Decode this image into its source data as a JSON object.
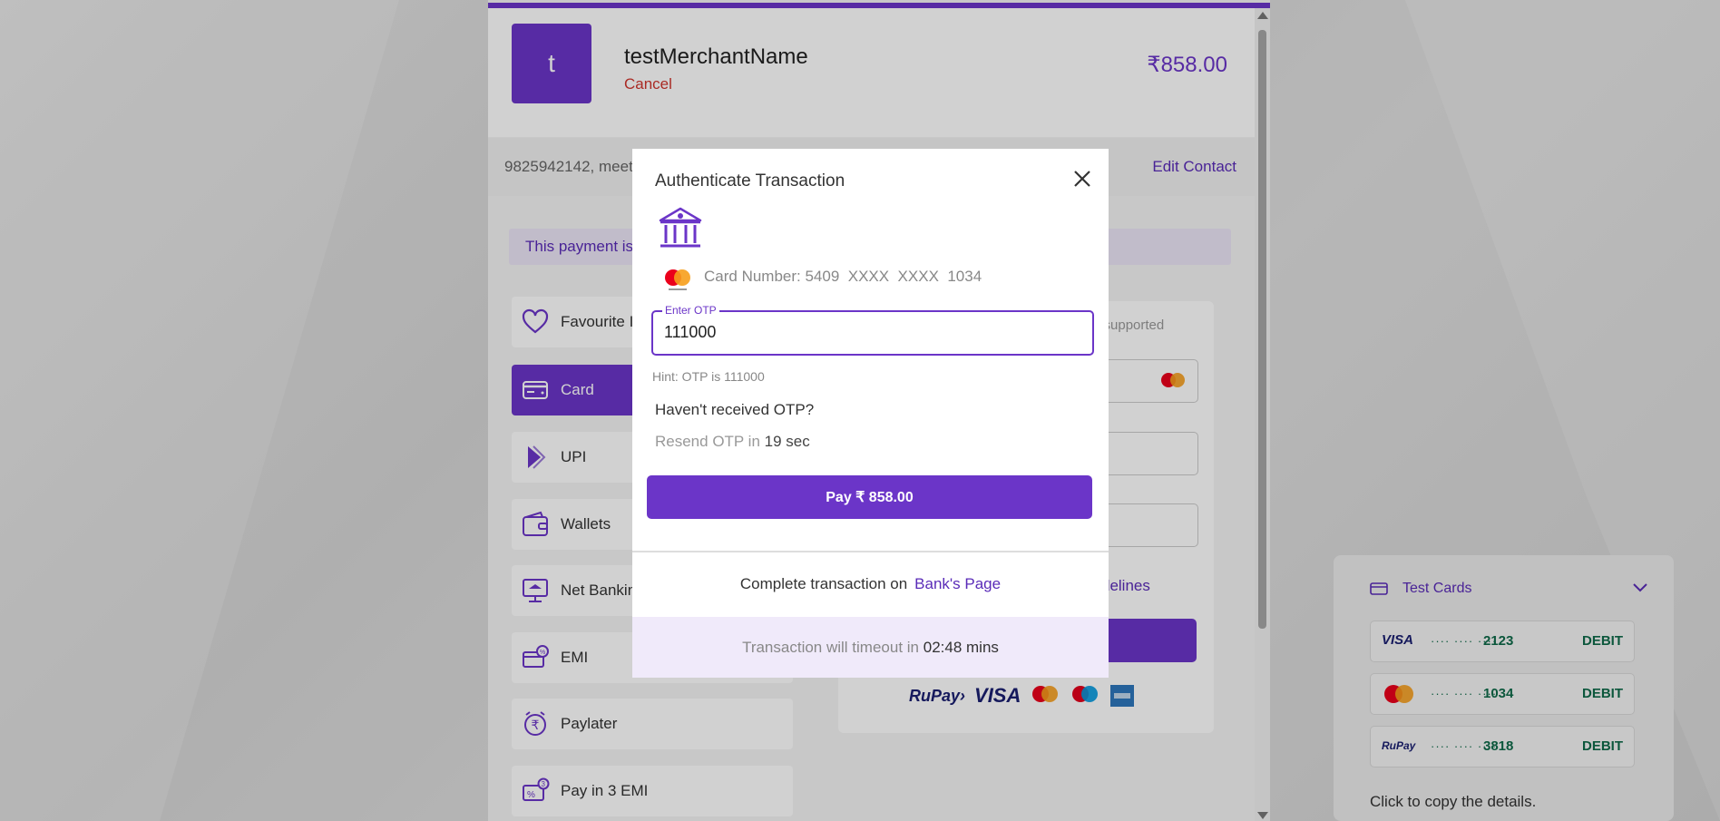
{
  "colors": {
    "accent": "#6b35c8",
    "cancel": "#d0342c",
    "debit": "#0f6b4a"
  },
  "merchant": {
    "logo_letter": "t",
    "name": "testMerchantName",
    "cancel_label": "Cancel",
    "amount": "₹858.00"
  },
  "contact": {
    "text": "9825942142, meet",
    "edit_label": "Edit Contact"
  },
  "notice": {
    "text": "This payment is"
  },
  "methods": [
    {
      "label": "Favourite I",
      "icon": "heart-icon"
    },
    {
      "label": "Card",
      "icon": "card-icon"
    },
    {
      "label": "UPI",
      "icon": "upi-icon"
    },
    {
      "label": "Wallets",
      "icon": "wallet-icon"
    },
    {
      "label": "Net Bankin",
      "icon": "net-banking-icon"
    },
    {
      "label": "EMI",
      "icon": "emi-icon"
    },
    {
      "label": "Paylater",
      "icon": "paylater-icon"
    },
    {
      "label": "Pay in 3 EMI",
      "icon": "pay-in-3-emi-icon"
    }
  ],
  "card_form": {
    "supported_text": "e supported",
    "guidelines_text": "delines"
  },
  "test_cards": {
    "title": "Test Cards",
    "rows": [
      {
        "brand": "VISA",
        "dots": "···· ···· ····",
        "last4": "2123",
        "type": "DEBIT"
      },
      {
        "brand": "MasterCard",
        "dots": "···· ···· ····",
        "last4": "1034",
        "type": "DEBIT"
      },
      {
        "brand": "RuPay",
        "dots": "···· ···· ····",
        "last4": "3818",
        "type": "DEBIT"
      }
    ],
    "hint": "Click to copy the details."
  },
  "modal": {
    "title": "Authenticate Transaction",
    "card_number": "Card Number: 5409  XXXX  XXXX  1034",
    "otp_label": "Enter OTP",
    "otp_value": "111000",
    "otp_hint": "Hint: OTP is 111000",
    "question": "Haven't received OTP?",
    "resend_prefix": "Resend OTP in",
    "resend_seconds": "19 sec",
    "pay_label": "Pay ₹ 858.00",
    "complete_prefix": "Complete transaction on",
    "bank_page_link": "Bank's Page",
    "timeout_prefix": "Transaction will timeout in",
    "timeout_value": "02:48 mins"
  }
}
